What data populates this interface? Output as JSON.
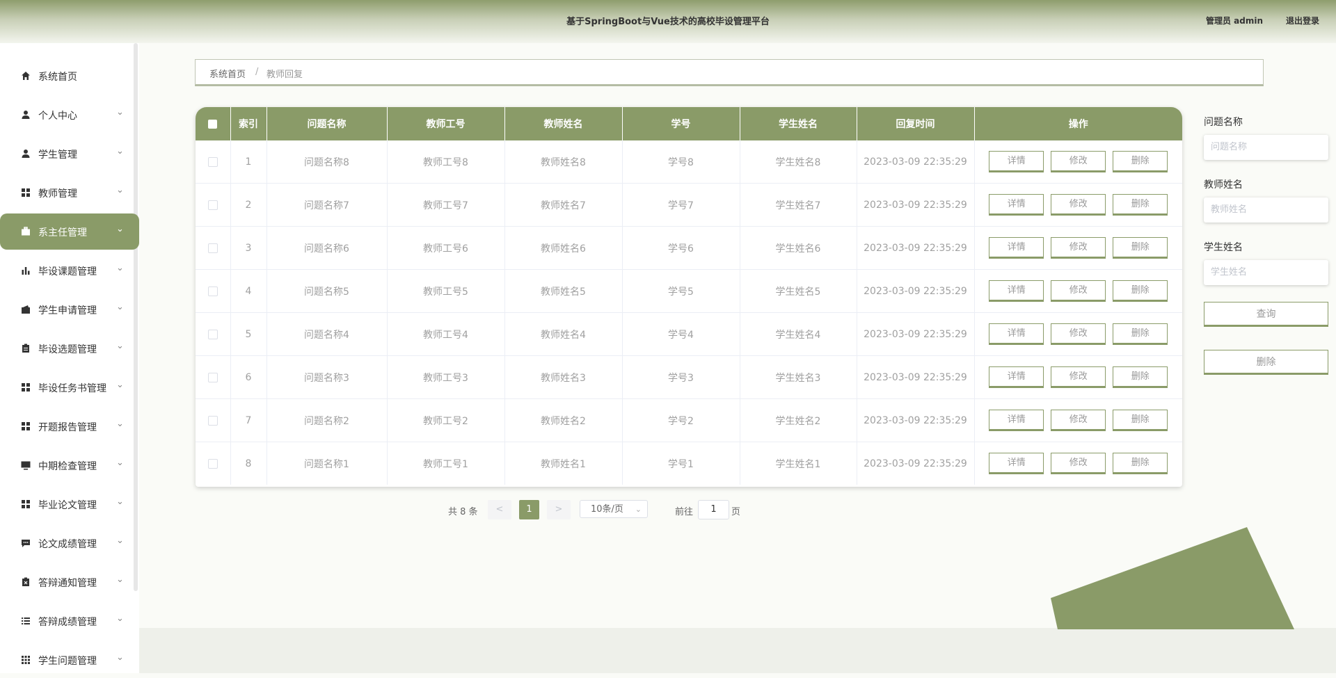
{
  "header": {
    "title": "基于SpringBoot与Vue技术的高校毕设管理平台",
    "user": "管理员 admin",
    "logout": "退出登录"
  },
  "sidebar": {
    "items": [
      {
        "label": "系统首页",
        "icon": "home-icon",
        "chevron": false
      },
      {
        "label": "个人中心",
        "icon": "user-icon",
        "chevron": true
      },
      {
        "label": "学生管理",
        "icon": "user-icon",
        "chevron": true
      },
      {
        "label": "教师管理",
        "icon": "grid-icon",
        "chevron": true
      },
      {
        "label": "系主任管理",
        "icon": "briefcase-icon",
        "chevron": true,
        "active": true
      },
      {
        "label": "毕设课题管理",
        "icon": "bar-chart-icon",
        "chevron": true
      },
      {
        "label": "学生申请管理",
        "icon": "wallet-icon",
        "chevron": true
      },
      {
        "label": "毕设选题管理",
        "icon": "clipboard-icon",
        "chevron": true
      },
      {
        "label": "毕设任务书管理",
        "icon": "grid-icon",
        "chevron": true
      },
      {
        "label": "开题报告管理",
        "icon": "grid-icon",
        "chevron": true
      },
      {
        "label": "中期检查管理",
        "icon": "monitor-icon",
        "chevron": true
      },
      {
        "label": "毕业论文管理",
        "icon": "grid-icon",
        "chevron": true
      },
      {
        "label": "论文成绩管理",
        "icon": "chat-icon",
        "chevron": true
      },
      {
        "label": "答辩通知管理",
        "icon": "clipboard-x-icon",
        "chevron": true
      },
      {
        "label": "答辩成绩管理",
        "icon": "list-icon",
        "chevron": true
      },
      {
        "label": "学生问题管理",
        "icon": "apps-icon",
        "chevron": true
      }
    ],
    "chevron_glyph": "⌄"
  },
  "breadcrumb": {
    "home": "系统首页",
    "separator": "/",
    "current": "教师回复"
  },
  "table": {
    "columns": [
      "索引",
      "问题名称",
      "教师工号",
      "教师姓名",
      "学号",
      "学生姓名",
      "回复时间",
      "操作"
    ],
    "rows": [
      [
        "1",
        "问题名称8",
        "教师工号8",
        "教师姓名8",
        "学号8",
        "学生姓名8",
        "2023-03-09 22:35:29"
      ],
      [
        "2",
        "问题名称7",
        "教师工号7",
        "教师姓名7",
        "学号7",
        "学生姓名7",
        "2023-03-09 22:35:29"
      ],
      [
        "3",
        "问题名称6",
        "教师工号6",
        "教师姓名6",
        "学号6",
        "学生姓名6",
        "2023-03-09 22:35:29"
      ],
      [
        "4",
        "问题名称5",
        "教师工号5",
        "教师姓名5",
        "学号5",
        "学生姓名5",
        "2023-03-09 22:35:29"
      ],
      [
        "5",
        "问题名称4",
        "教师工号4",
        "教师姓名4",
        "学号4",
        "学生姓名4",
        "2023-03-09 22:35:29"
      ],
      [
        "6",
        "问题名称3",
        "教师工号3",
        "教师姓名3",
        "学号3",
        "学生姓名3",
        "2023-03-09 22:35:29"
      ],
      [
        "7",
        "问题名称2",
        "教师工号2",
        "教师姓名2",
        "学号2",
        "学生姓名2",
        "2023-03-09 22:35:29"
      ],
      [
        "8",
        "问题名称1",
        "教师工号1",
        "教师姓名1",
        "学号1",
        "学生姓名1",
        "2023-03-09 22:35:29"
      ]
    ],
    "actions": {
      "detail": "详情",
      "edit": "修改",
      "delete": "删除"
    }
  },
  "pagination": {
    "total": "共 8 条",
    "prev": "<",
    "next": ">",
    "current": "1",
    "page_size": "10条/页",
    "goto": "前往",
    "goto_value": "1",
    "unit": "页"
  },
  "filters": [
    {
      "label": "问题名称",
      "placeholder": "问题名称"
    },
    {
      "label": "教师姓名",
      "placeholder": "教师姓名"
    },
    {
      "label": "学生姓名",
      "placeholder": "学生姓名"
    }
  ],
  "buttons": {
    "search": "查询",
    "delete": "删除"
  },
  "colors": {
    "accent": "#8a9b68"
  }
}
